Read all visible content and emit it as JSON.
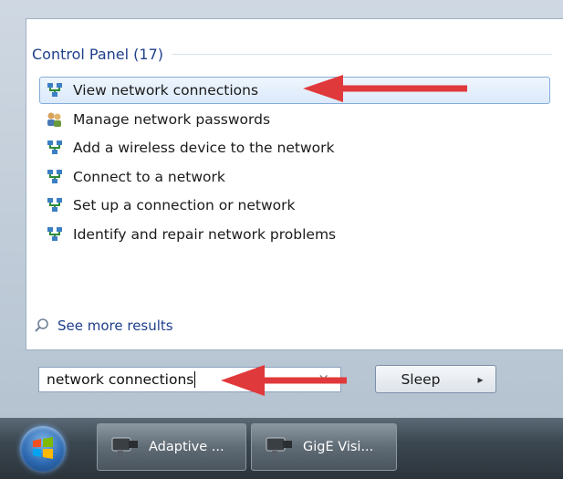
{
  "start_menu": {
    "group_title": "Control Panel (17)",
    "results": [
      {
        "label": "View network connections",
        "icon": "network-icon",
        "selected": true
      },
      {
        "label": "Manage network passwords",
        "icon": "users-key-icon",
        "selected": false
      },
      {
        "label": "Add a wireless device to the network",
        "icon": "network-icon",
        "selected": false
      },
      {
        "label": "Connect to a network",
        "icon": "network-icon",
        "selected": false
      },
      {
        "label": "Set up a connection or network",
        "icon": "network-icon",
        "selected": false
      },
      {
        "label": "Identify and repair network problems",
        "icon": "network-icon",
        "selected": false
      }
    ],
    "see_more_label": "See more results",
    "search": {
      "value": "network connections",
      "clear_glyph": "×"
    },
    "power_button_label": "Sleep",
    "power_arrow_glyph": "▸"
  },
  "taskbar": {
    "items": [
      {
        "label": "Adaptive ...",
        "icon": "camera-icon"
      },
      {
        "label": "GigE Visi...",
        "icon": "camera-icon"
      }
    ]
  },
  "annotations": {
    "arrow_color": "#e0393b"
  }
}
